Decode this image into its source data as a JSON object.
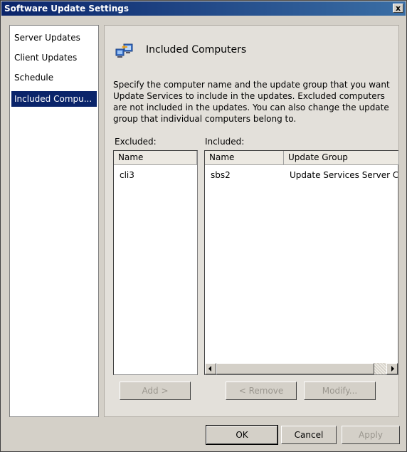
{
  "window": {
    "title": "Software Update Settings",
    "close_glyph": "x"
  },
  "nav": {
    "items": [
      {
        "label": "Server Updates",
        "selected": false
      },
      {
        "label": "Client Updates",
        "selected": false
      },
      {
        "label": "Schedule",
        "selected": false
      },
      {
        "label": "Included Compu...",
        "selected": true
      }
    ]
  },
  "panel": {
    "icon": "computers-icon",
    "title": "Included Computers",
    "description": "Specify the computer name and the update group that you want Update Services to include in the updates. Excluded computers are not included in the updates. You can also change the update group that individual computers belong to."
  },
  "excluded": {
    "label": "Excluded:",
    "columns": [
      "Name"
    ],
    "rows": [
      {
        "name": "cli3"
      }
    ]
  },
  "included": {
    "label": "Included:",
    "columns": [
      "Name",
      "Update Group"
    ],
    "rows": [
      {
        "name": "sbs2",
        "group": "Update Services Server Co"
      }
    ]
  },
  "actions": {
    "add": "Add >",
    "remove": "< Remove",
    "modify": "Modify..."
  },
  "footer": {
    "ok": "OK",
    "cancel": "Cancel",
    "apply": "Apply"
  },
  "colors": {
    "selection": "#0a246a",
    "title_start": "#0a246a",
    "title_end": "#3a6ea5"
  }
}
